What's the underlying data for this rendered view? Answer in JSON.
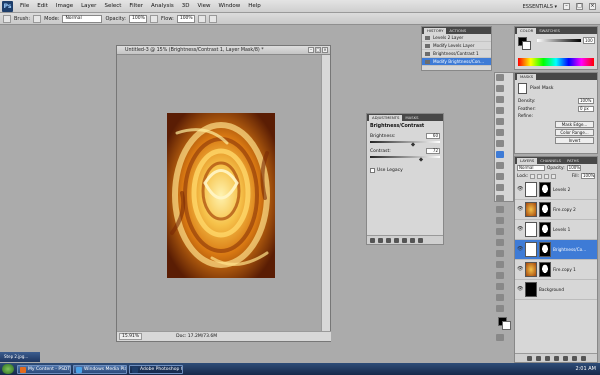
{
  "app": {
    "logo": "Ps"
  },
  "menu": [
    "File",
    "Edit",
    "Image",
    "Layer",
    "Select",
    "Filter",
    "Analysis",
    "3D",
    "View",
    "Window",
    "Help"
  ],
  "workspace": "ESSENTIALS ▾",
  "options": {
    "brush_label": "Brush:",
    "mode_label": "Mode:",
    "mode_value": "Normal",
    "opacity_label": "Opacity:",
    "opacity_value": "100%",
    "flow_label": "Flow:",
    "flow_value": "100%"
  },
  "document": {
    "title": "Untitled-3 @ 15% (Brightness/Contrast 1, Layer Mask/8) *",
    "zoom": "15.91%",
    "doc_info": "Doc: 17.2M/73.6M"
  },
  "history": {
    "tabs": [
      "HISTORY",
      "ACTIONS"
    ],
    "items": [
      {
        "label": "Levels 2 Layer",
        "active": false
      },
      {
        "label": "Modify Levels Layer",
        "active": false
      },
      {
        "label": "Brightness/Contrast 1 Layer",
        "active": false
      },
      {
        "label": "Modify Brightness/Con...",
        "active": true
      }
    ]
  },
  "color_panel": {
    "tabs": [
      "COLOR",
      "SWATCHES"
    ],
    "k_value": "100"
  },
  "masks": {
    "tabs": [
      "MASKS"
    ],
    "title": "Pixel Mask",
    "density_label": "Density:",
    "density_value": "100%",
    "feather_label": "Feather:",
    "feather_value": "0 px",
    "refine_label": "Refine:",
    "buttons": [
      "Mask Edge...",
      "Color Range...",
      "Invert"
    ]
  },
  "adjustments": {
    "tabs": [
      "ADJUSTMENTS",
      "MASKS"
    ],
    "title": "Brightness/Contrast",
    "brightness_label": "Brightness:",
    "brightness_value": "60",
    "brightness_level": 0.62,
    "contrast_label": "Contrast:",
    "contrast_value": "72",
    "contrast_level": 0.73,
    "use_legacy_label": "Use Legacy"
  },
  "layers": {
    "tabs": [
      "LAYERS",
      "CHANNELS",
      "PATHS"
    ],
    "blend_mode": "Normal",
    "opacity_label": "Opacity:",
    "opacity_value": "100%",
    "lock_label": "Lock:",
    "fill_label": "Fill:",
    "fill_value": "100%",
    "items": [
      {
        "name": "Levels 2",
        "kind": "adj",
        "active": false
      },
      {
        "name": "Fire.copy 2",
        "kind": "art",
        "active": false
      },
      {
        "name": "Levels 1",
        "kind": "adj",
        "active": false
      },
      {
        "name": "Brightness/Co...",
        "kind": "adj",
        "active": true
      },
      {
        "name": "Fire.copy 1",
        "kind": "art",
        "active": false
      },
      {
        "name": "Background",
        "kind": "black",
        "active": false
      }
    ]
  },
  "taskbar": {
    "minimized": "Step 2.jpg...",
    "tasks": [
      {
        "label": "My Content - PSDTy...",
        "active": false,
        "color": "#e36b1e"
      },
      {
        "label": "Windows Media Player",
        "active": false,
        "color": "#4aa2e8"
      },
      {
        "label": "Adobe Photoshop C...",
        "active": true,
        "color": "#1e3e6b"
      }
    ],
    "clock": "2:01 AM"
  },
  "colors": {
    "accent": "#3e7bd6",
    "panel_bg": "#d7d7d7",
    "canvas_bg": "#a9a9a9"
  }
}
